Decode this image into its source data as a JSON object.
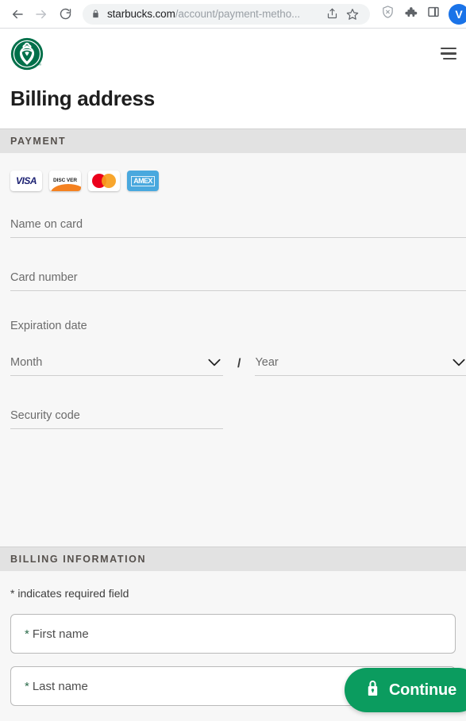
{
  "browser": {
    "back_icon": "arrow-left-icon",
    "forward_icon": "arrow-right-icon",
    "reload_icon": "reload-icon",
    "lock_icon": "lock-icon",
    "url_host": "starbucks.com",
    "url_path": "/account/payment-metho...",
    "share_icon": "share-icon",
    "bookmark_icon": "star-icon",
    "shield_icon": "shield-icon",
    "extensions_icon": "puzzle-icon",
    "sidepanel_icon": "side-panel-icon",
    "avatar_initial": "V"
  },
  "site_header": {
    "logo_name": "starbucks-logo",
    "menu_icon": "hamburger-menu-icon"
  },
  "page": {
    "title": "Billing address"
  },
  "payment_section": {
    "heading": "PAYMENT",
    "cards": [
      {
        "name": "visa-card-logo",
        "label": "VISA"
      },
      {
        "name": "discover-card-logo",
        "label": "DISC VER"
      },
      {
        "name": "mastercard-card-logo",
        "label": "Mastercard"
      },
      {
        "name": "amex-card-logo",
        "label": "AMEX"
      }
    ],
    "name_on_card_placeholder": "Name on card",
    "card_number_placeholder": "Card number",
    "expiration_label": "Expiration date",
    "month_placeholder": "Month",
    "separator": "/",
    "year_placeholder": "Year",
    "security_code_placeholder": "Security code"
  },
  "billing_section": {
    "heading": "BILLING INFORMATION",
    "required_note": "* indicates required field",
    "first_name": {
      "star": "*",
      "placeholder": "First name"
    },
    "last_name": {
      "star": "*",
      "placeholder": "Last name"
    }
  },
  "footer": {
    "continue_label": "Continue",
    "continue_icon": "lock-icon",
    "accent_color": "#0b9c5f"
  }
}
